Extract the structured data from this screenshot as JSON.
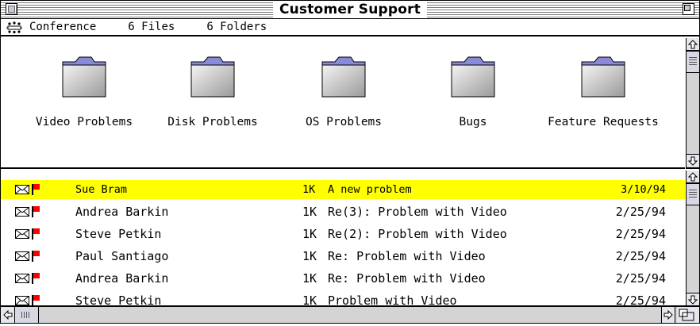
{
  "window": {
    "title": "Customer Support"
  },
  "infobar": {
    "conference_label": "Conference",
    "files": "6 Files",
    "folders": "6 Folders"
  },
  "folders": [
    {
      "label": "Video Problems"
    },
    {
      "label": "Disk Problems"
    },
    {
      "label": "OS Problems"
    },
    {
      "label": "Bugs"
    },
    {
      "label": "Feature Requests"
    }
  ],
  "messages": [
    {
      "sender": "Sue Bram",
      "size": "1K",
      "subject": "A new problem",
      "date": "3/10/94",
      "selected": true
    },
    {
      "sender": "Andrea Barkin",
      "size": "1K",
      "subject": "Re(3): Problem with Video",
      "date": "2/25/94",
      "selected": false
    },
    {
      "sender": "Steve Petkin",
      "size": "1K",
      "subject": "Re(2): Problem with Video",
      "date": "2/25/94",
      "selected": false
    },
    {
      "sender": "Paul Santiago",
      "size": "1K",
      "subject": "Re: Problem with Video",
      "date": "2/25/94",
      "selected": false
    },
    {
      "sender": "Andrea Barkin",
      "size": "1K",
      "subject": "Re: Problem with Video",
      "date": "2/25/94",
      "selected": false
    },
    {
      "sender": "Steve Petkin",
      "size": "1K",
      "subject": "Problem with Video",
      "date": "2/25/94",
      "selected": false
    }
  ],
  "colors": {
    "selection": "#ffff00",
    "flag": "#ff0000"
  },
  "icons": {
    "conference": "conference-icon",
    "folder": "folder-icon",
    "message": "envelope-icon",
    "priority": "flag-icon"
  }
}
